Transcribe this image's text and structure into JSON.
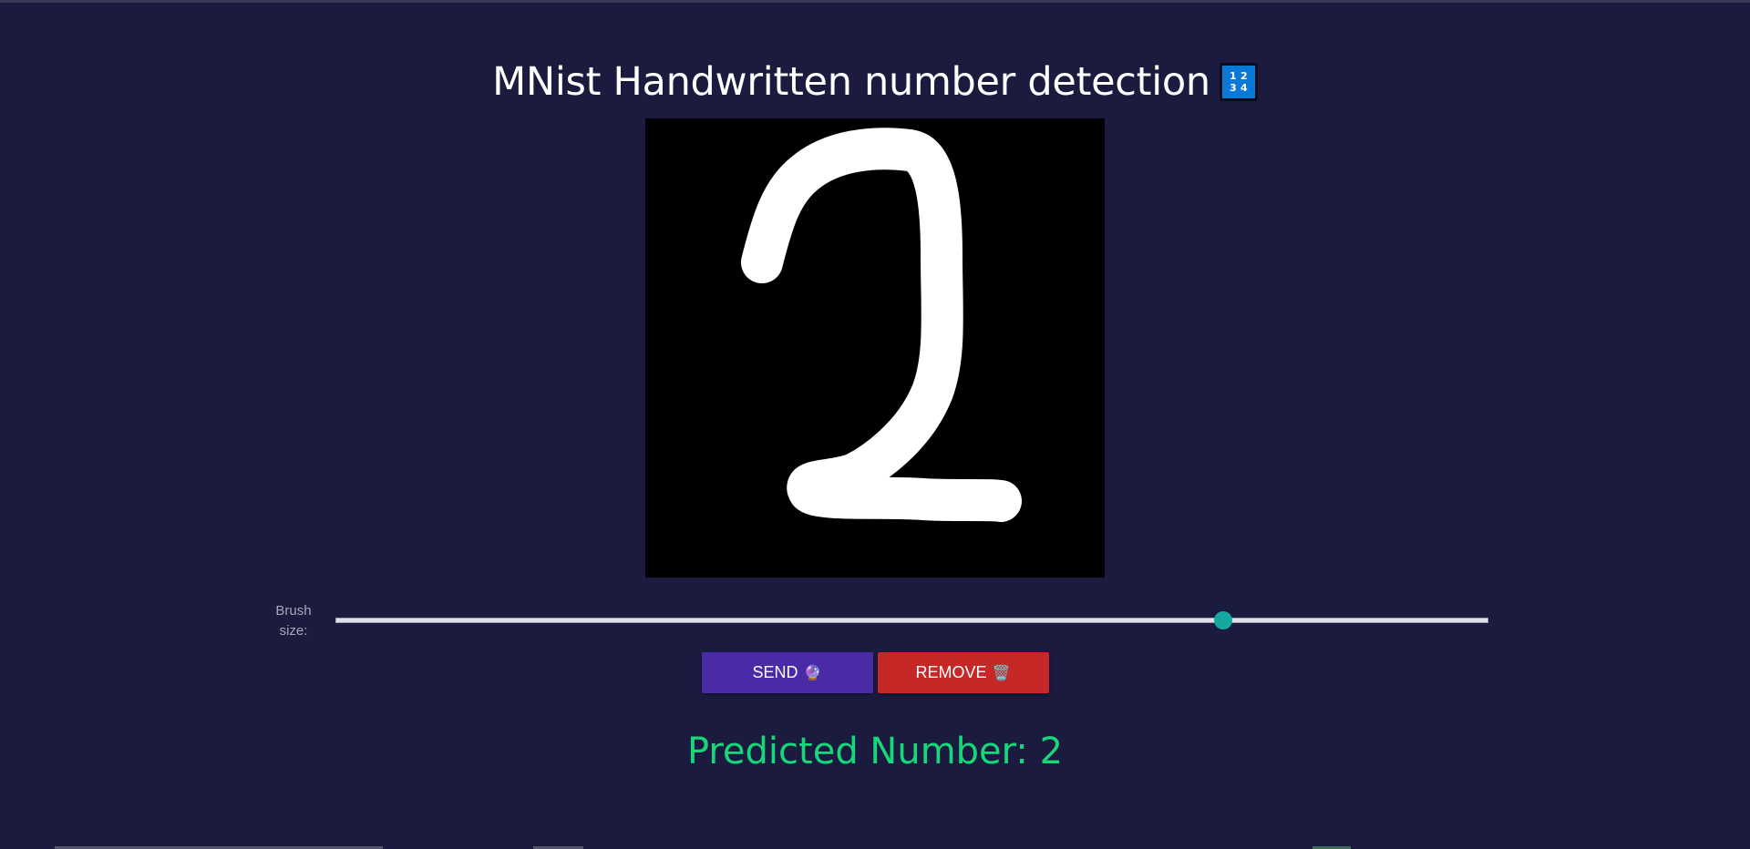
{
  "header": {
    "title": "MNist Handwritten number detection",
    "icon": "input-numbers-icon",
    "icon_glyph_rows": [
      "1 2",
      "3 4"
    ]
  },
  "canvas": {
    "background": "#000000",
    "stroke_color": "#ffffff",
    "drawn_digit": "2"
  },
  "controls": {
    "brush_label": "Brush size:",
    "brush_size_fraction": 0.77,
    "send_label": "SEND",
    "send_icon": "crystal-ball-icon",
    "remove_label": "REMOVE",
    "remove_icon": "wastebasket-icon"
  },
  "result": {
    "prediction_text": "Predicted Number: 2"
  },
  "colors": {
    "background": "#1b1b40",
    "send_button": "#4a2aa6",
    "remove_button": "#c62828",
    "prediction": "#18d77a",
    "slider_thumb": "#16a89e"
  }
}
